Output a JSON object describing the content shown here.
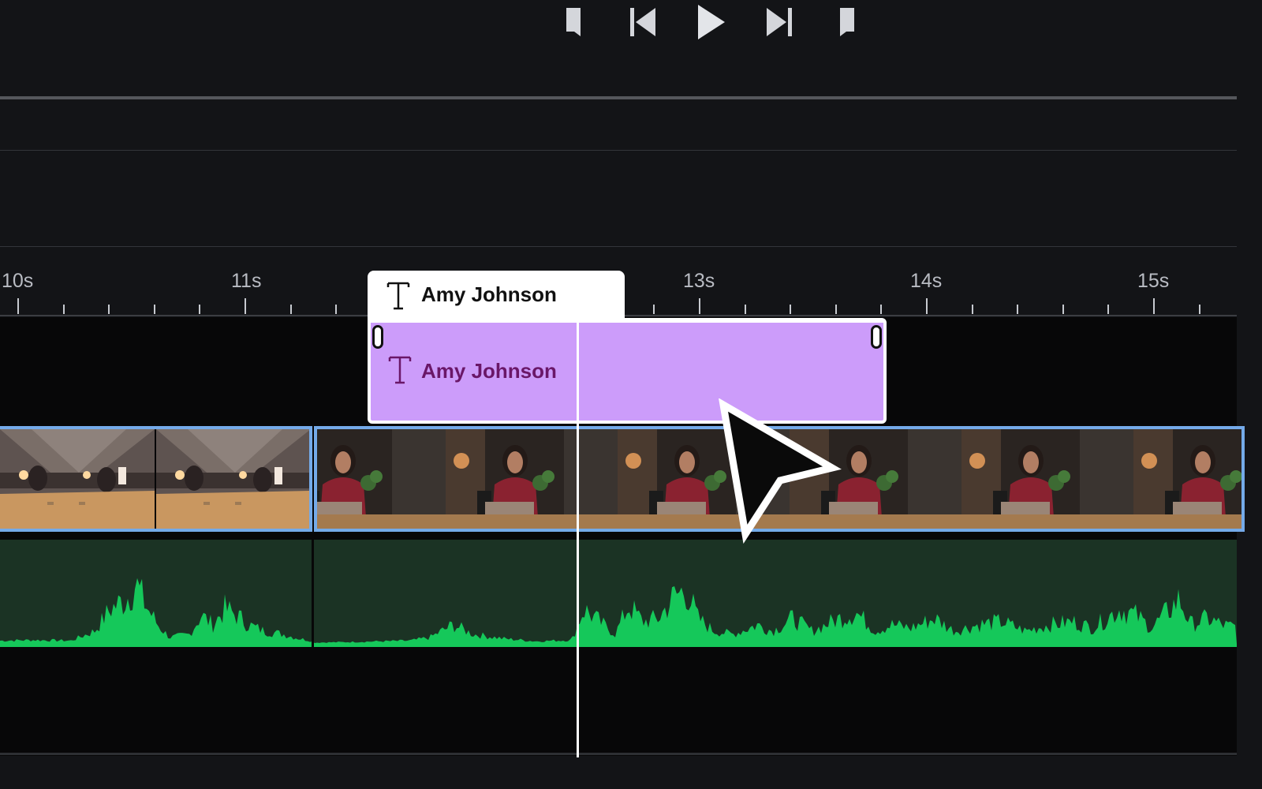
{
  "transport": {
    "buttons": [
      {
        "icon": "mark-in-icon"
      },
      {
        "icon": "skip-back-icon"
      },
      {
        "icon": "play-icon"
      },
      {
        "icon": "skip-forward-icon"
      },
      {
        "icon": "mark-out-icon"
      }
    ]
  },
  "ruler": {
    "labels": [
      "10s",
      "11s",
      "13s",
      "14s",
      "15s"
    ]
  },
  "title_clip": {
    "tab_label": "Amy Johnson",
    "body_label": "Amy Johnson",
    "icon": "text-icon",
    "color": "#cc9cfa",
    "text_color": "#6a1768"
  },
  "video_track": {
    "clips": [
      {
        "name": "meeting-room-clip",
        "frames": 2
      },
      {
        "name": "woman-at-desk-clip",
        "frames": 6
      }
    ],
    "border_color": "#74aae9"
  },
  "audio_track": {
    "waveform_color": "#15c85a",
    "background": "#1b3324"
  },
  "playhead": {
    "color": "#ffffff"
  },
  "cursor": {
    "icon": "arrow-cursor-icon"
  }
}
